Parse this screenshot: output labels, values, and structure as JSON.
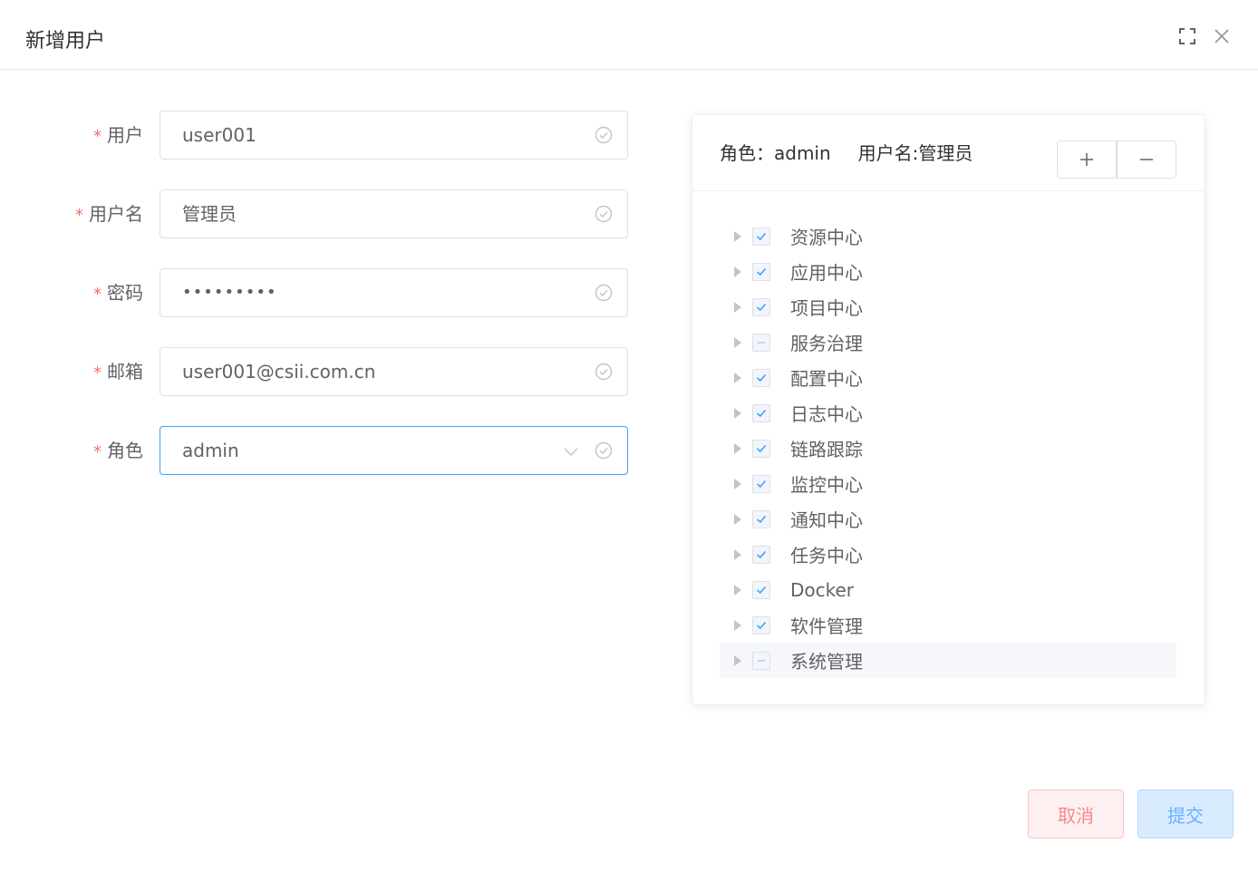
{
  "dialog": {
    "title": "新增用户",
    "fullscreen_icon": "fullscreen-icon",
    "close_icon": "close-icon"
  },
  "form": {
    "fields": [
      {
        "label": "用户",
        "value": "user001",
        "type": "text"
      },
      {
        "label": "用户名",
        "value": "管理员",
        "type": "text"
      },
      {
        "label": "密码",
        "value": "•••••••••",
        "type": "password"
      },
      {
        "label": "邮箱",
        "value": "user001@csii.com.cn",
        "type": "text"
      },
      {
        "label": "角色",
        "value": "admin",
        "type": "select"
      }
    ],
    "required_mark": "*"
  },
  "panel": {
    "role_text": "角色：admin",
    "username_text": "用户名:管理员",
    "expand_label": "+",
    "collapse_label": "−",
    "tree": [
      {
        "label": "资源中心",
        "state": "checked"
      },
      {
        "label": "应用中心",
        "state": "checked"
      },
      {
        "label": "项目中心",
        "state": "checked"
      },
      {
        "label": "服务治理",
        "state": "indeterminate"
      },
      {
        "label": "配置中心",
        "state": "checked"
      },
      {
        "label": "日志中心",
        "state": "checked"
      },
      {
        "label": "链路跟踪",
        "state": "checked"
      },
      {
        "label": "监控中心",
        "state": "checked"
      },
      {
        "label": "通知中心",
        "state": "checked"
      },
      {
        "label": "任务中心",
        "state": "checked"
      },
      {
        "label": "Docker",
        "state": "checked"
      },
      {
        "label": "软件管理",
        "state": "checked"
      },
      {
        "label": "系统管理",
        "state": "indeterminate"
      }
    ]
  },
  "footer": {
    "cancel_label": "取消",
    "submit_label": "提交"
  },
  "colors": {
    "primary": "#409eff",
    "danger": "#f56c6c",
    "check": "#409eff",
    "valid": "#c0c4cc"
  }
}
